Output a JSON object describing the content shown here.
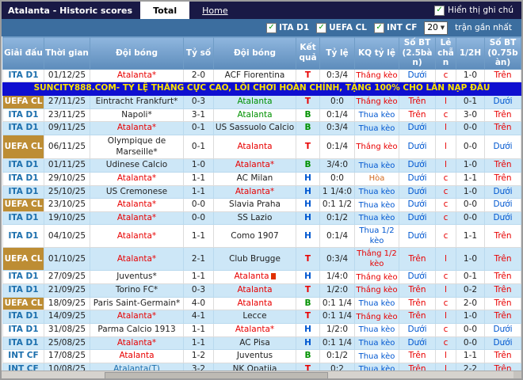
{
  "title_bar": {
    "title": "Atalanta - Historic scores",
    "tabs": [
      {
        "label": "Total",
        "active": true
      },
      {
        "label": "Home",
        "active": false
      }
    ],
    "note_checkbox_label": "Hiển thị ghi chú",
    "note_checked": true
  },
  "filter_bar": {
    "leagues": [
      {
        "label": "ITA D1",
        "checked": true
      },
      {
        "label": "UEFA CL",
        "checked": true
      },
      {
        "label": "INT CF",
        "checked": true
      }
    ],
    "match_count": "20",
    "match_count_suffix": "trận gần nhất"
  },
  "ad": {
    "text": "SUNCITY888.COM- TỶ LỆ THẮNG CỰC CAO, LỐI CHƠI HOÀN CHỈNH, TẶNG 100% CHO LẦN NẠP ĐẦU"
  },
  "colors": {
    "accent_red": "#e80000",
    "accent_blue": "#0057d0",
    "result_green": "#009100",
    "draw_orange": "#d2691e",
    "league_blue": "#1c6fad",
    "uefa_gold": "#bd8d34",
    "row_alt": "#cde7f7",
    "header_blue": "#5d8cbb",
    "titlebar_navy": "#191945",
    "filterbar_blue": "#3c6e9f",
    "ad_bg": "#0f0fd0",
    "ad_text": "#ffe400"
  },
  "table": {
    "headers": [
      "Giải đấu",
      "Thời gian",
      "Đội bóng",
      "Tỷ số",
      "Đội bóng",
      "Kết quả",
      "Tỷ lệ",
      "KQ tỷ lệ",
      "Số BT (2.5bàn)",
      "Lẻ chẵn",
      "1/2H",
      "Số BT (0.75bàn)"
    ],
    "rows": [
      {
        "l": "ITA D1",
        "lc": "ita",
        "d": "01/12/25",
        "h": "Atalanta*",
        "hc": "red",
        "s": "2-0",
        "a": "ACF Fiorentina",
        "ac": "black",
        "r": "T",
        "rc": "red",
        "o": "0:3/4",
        "k": "Thắng kèo",
        "kc": "red",
        "g": "Dưới",
        "gc": "blue",
        "e": "c",
        "ec": "red",
        "f": "1-0",
        "t": "Trên",
        "tc": "red",
        "icon": false
      },
      {
        "l": "UEFA CL",
        "lc": "uefa",
        "d": "27/11/25",
        "h": "Eintracht Frankfurt*",
        "hc": "black",
        "s": "0-3",
        "a": "Atalanta",
        "ac": "green",
        "r": "T",
        "rc": "red",
        "o": "0:0",
        "k": "Thắng kèo",
        "kc": "red",
        "g": "Trên",
        "gc": "red",
        "e": "l",
        "ec": "red",
        "f": "0-1",
        "t": "Dưới",
        "tc": "blue",
        "icon": false
      },
      {
        "l": "ITA D1",
        "lc": "ita",
        "d": "23/11/25",
        "h": "Napoli*",
        "hc": "black",
        "s": "3-1",
        "a": "Atalanta",
        "ac": "green",
        "r": "B",
        "rc": "green",
        "o": "0:1/4",
        "k": "Thua kèo",
        "kc": "blue",
        "g": "Trên",
        "gc": "red",
        "e": "c",
        "ec": "red",
        "f": "3-0",
        "t": "Trên",
        "tc": "red",
        "icon": false
      },
      {
        "l": "ITA D1",
        "lc": "ita",
        "d": "09/11/25",
        "h": "Atalanta*",
        "hc": "red",
        "s": "0-1",
        "a": "US Sassuolo Calcio",
        "ac": "black",
        "r": "B",
        "rc": "green",
        "o": "0:3/4",
        "k": "Thua kèo",
        "kc": "blue",
        "g": "Dưới",
        "gc": "blue",
        "e": "l",
        "ec": "red",
        "f": "0-0",
        "t": "Trên",
        "tc": "red",
        "icon": false
      },
      {
        "l": "UEFA CL",
        "lc": "uefa",
        "d": "06/11/25",
        "h": "Olympique de Marseille*",
        "hc": "black",
        "s": "0-1",
        "a": "Atalanta",
        "ac": "red",
        "r": "T",
        "rc": "red",
        "o": "0:1/4",
        "k": "Thắng kèo",
        "kc": "red",
        "g": "Dưới",
        "gc": "blue",
        "e": "l",
        "ec": "red",
        "f": "0-0",
        "t": "Dưới",
        "tc": "blue",
        "icon": false
      },
      {
        "l": "ITA D1",
        "lc": "ita",
        "d": "01/11/25",
        "h": "Udinese Calcio",
        "hc": "black",
        "s": "1-0",
        "a": "Atalanta*",
        "ac": "red",
        "r": "B",
        "rc": "green",
        "o": "3/4:0",
        "k": "Thua kèo",
        "kc": "blue",
        "g": "Dưới",
        "gc": "blue",
        "e": "l",
        "ec": "red",
        "f": "1-0",
        "t": "Trên",
        "tc": "red",
        "icon": false
      },
      {
        "l": "ITA D1",
        "lc": "ita",
        "d": "29/10/25",
        "h": "Atalanta*",
        "hc": "red",
        "s": "1-1",
        "a": "AC Milan",
        "ac": "black",
        "r": "H",
        "rc": "blue",
        "o": "0:0",
        "k": "Hòa",
        "kc": "orange",
        "g": "Dưới",
        "gc": "blue",
        "e": "c",
        "ec": "red",
        "f": "1-1",
        "t": "Trên",
        "tc": "red",
        "icon": false
      },
      {
        "l": "ITA D1",
        "lc": "ita",
        "d": "25/10/25",
        "h": "US Cremonese",
        "hc": "black",
        "s": "1-1",
        "a": "Atalanta*",
        "ac": "red",
        "r": "H",
        "rc": "blue",
        "o": "1 1/4:0",
        "k": "Thua kèo",
        "kc": "blue",
        "g": "Dưới",
        "gc": "blue",
        "e": "c",
        "ec": "red",
        "f": "1-0",
        "t": "Dưới",
        "tc": "blue",
        "icon": false
      },
      {
        "l": "UEFA CL",
        "lc": "uefa",
        "d": "23/10/25",
        "h": "Atalanta*",
        "hc": "red",
        "s": "0-0",
        "a": "Slavia Praha",
        "ac": "black",
        "r": "H",
        "rc": "blue",
        "o": "0:1 1/2",
        "k": "Thua kèo",
        "kc": "blue",
        "g": "Dưới",
        "gc": "blue",
        "e": "c",
        "ec": "red",
        "f": "0-0",
        "t": "Dưới",
        "tc": "blue",
        "icon": false
      },
      {
        "l": "ITA D1",
        "lc": "ita",
        "d": "19/10/25",
        "h": "Atalanta*",
        "hc": "red",
        "s": "0-0",
        "a": "SS Lazio",
        "ac": "black",
        "r": "H",
        "rc": "blue",
        "o": "0:1/2",
        "k": "Thua kèo",
        "kc": "blue",
        "g": "Dưới",
        "gc": "blue",
        "e": "c",
        "ec": "red",
        "f": "0-0",
        "t": "Dưới",
        "tc": "blue",
        "icon": false
      },
      {
        "l": "ITA D1",
        "lc": "ita",
        "d": "04/10/25",
        "h": "Atalanta*",
        "hc": "red",
        "s": "1-1",
        "a": "Como 1907",
        "ac": "black",
        "r": "H",
        "rc": "blue",
        "o": "0:1/4",
        "k": "Thua 1/2 kèo",
        "kc": "blue",
        "g": "Dưới",
        "gc": "blue",
        "e": "c",
        "ec": "red",
        "f": "1-1",
        "t": "Trên",
        "tc": "red",
        "icon": false
      },
      {
        "l": "UEFA CL",
        "lc": "uefa",
        "d": "01/10/25",
        "h": "Atalanta*",
        "hc": "red",
        "s": "2-1",
        "a": "Club Brugge",
        "ac": "black",
        "r": "T",
        "rc": "red",
        "o": "0:3/4",
        "k": "Thắng 1/2 kèo",
        "kc": "red",
        "g": "Trên",
        "gc": "red",
        "e": "l",
        "ec": "red",
        "f": "1-0",
        "t": "Trên",
        "tc": "red",
        "icon": false
      },
      {
        "l": "ITA D1",
        "lc": "ita",
        "d": "27/09/25",
        "h": "Juventus*",
        "hc": "black",
        "s": "1-1",
        "a": "Atalanta",
        "ac": "red",
        "r": "H",
        "rc": "blue",
        "o": "1/4:0",
        "k": "Thắng kèo",
        "kc": "red",
        "g": "Dưới",
        "gc": "blue",
        "e": "c",
        "ec": "red",
        "f": "0-1",
        "t": "Trên",
        "tc": "red",
        "icon": true
      },
      {
        "l": "ITA D1",
        "lc": "ita",
        "d": "21/09/25",
        "h": "Torino FC*",
        "hc": "black",
        "s": "0-3",
        "a": "Atalanta",
        "ac": "red",
        "r": "T",
        "rc": "red",
        "o": "1/2:0",
        "k": "Thắng kèo",
        "kc": "red",
        "g": "Trên",
        "gc": "red",
        "e": "l",
        "ec": "red",
        "f": "0-2",
        "t": "Trên",
        "tc": "red",
        "icon": false
      },
      {
        "l": "UEFA CL",
        "lc": "uefa",
        "d": "18/09/25",
        "h": "Paris Saint-Germain*",
        "hc": "black",
        "s": "4-0",
        "a": "Atalanta",
        "ac": "red",
        "r": "B",
        "rc": "green",
        "o": "0:1 1/4",
        "k": "Thua kèo",
        "kc": "blue",
        "g": "Trên",
        "gc": "red",
        "e": "c",
        "ec": "red",
        "f": "2-0",
        "t": "Trên",
        "tc": "red",
        "icon": false
      },
      {
        "l": "ITA D1",
        "lc": "ita",
        "d": "14/09/25",
        "h": "Atalanta*",
        "hc": "red",
        "s": "4-1",
        "a": "Lecce",
        "ac": "black",
        "r": "T",
        "rc": "red",
        "o": "0:1 1/4",
        "k": "Thắng kèo",
        "kc": "red",
        "g": "Trên",
        "gc": "red",
        "e": "l",
        "ec": "red",
        "f": "1-0",
        "t": "Trên",
        "tc": "red",
        "icon": false
      },
      {
        "l": "ITA D1",
        "lc": "ita",
        "d": "31/08/25",
        "h": "Parma Calcio 1913",
        "hc": "black",
        "s": "1-1",
        "a": "Atalanta*",
        "ac": "red",
        "r": "H",
        "rc": "blue",
        "o": "1/2:0",
        "k": "Thua kèo",
        "kc": "blue",
        "g": "Dưới",
        "gc": "blue",
        "e": "c",
        "ec": "red",
        "f": "0-0",
        "t": "Dưới",
        "tc": "blue",
        "icon": false
      },
      {
        "l": "ITA D1",
        "lc": "ita",
        "d": "25/08/25",
        "h": "Atalanta*",
        "hc": "red",
        "s": "1-1",
        "a": "AC Pisa",
        "ac": "black",
        "r": "H",
        "rc": "blue",
        "o": "0:1 1/4",
        "k": "Thua kèo",
        "kc": "blue",
        "g": "Dưới",
        "gc": "blue",
        "e": "c",
        "ec": "red",
        "f": "0-0",
        "t": "Dưới",
        "tc": "blue",
        "icon": false
      },
      {
        "l": "INT CF",
        "lc": "int",
        "d": "17/08/25",
        "h": "Atalanta",
        "hc": "red",
        "s": "1-2",
        "a": "Juventus",
        "ac": "black",
        "r": "B",
        "rc": "green",
        "o": "0:1/2",
        "k": "Thua kèo",
        "kc": "blue",
        "g": "Trên",
        "gc": "red",
        "e": "l",
        "ec": "red",
        "f": "1-1",
        "t": "Trên",
        "tc": "red",
        "icon": false
      },
      {
        "l": "INT CF",
        "lc": "int",
        "d": "10/08/25",
        "h": "Atalanta(T)",
        "hc": "tblue",
        "s": "3-2",
        "a": "NK Opatija",
        "ac": "black",
        "r": "T",
        "rc": "red",
        "o": "0:2",
        "k": "Thua kèo",
        "kc": "blue",
        "g": "Trên",
        "gc": "red",
        "e": "l",
        "ec": "red",
        "f": "2-2",
        "t": "Trên",
        "tc": "red",
        "icon": false
      }
    ]
  }
}
